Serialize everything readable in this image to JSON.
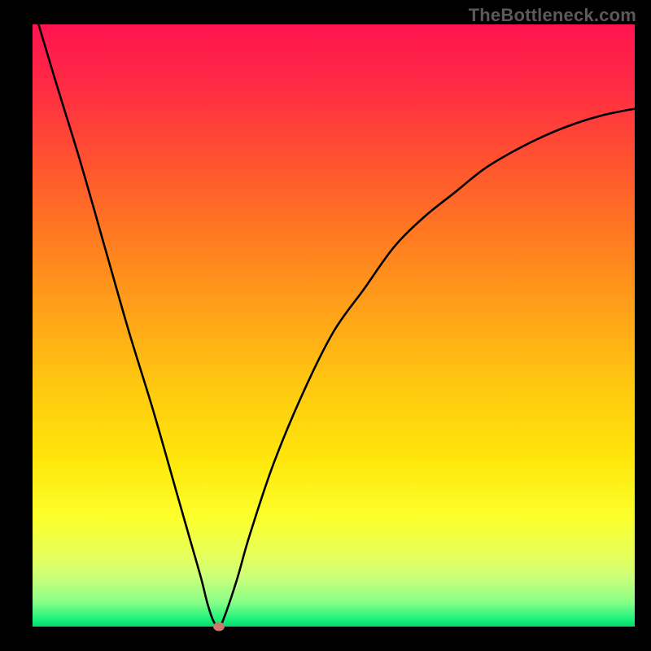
{
  "watermark": "TheBottleneck.com",
  "chart_data": {
    "type": "line",
    "title": "",
    "xlabel": "",
    "ylabel": "",
    "xlim": [
      0,
      100
    ],
    "ylim": [
      0,
      100
    ],
    "grid": false,
    "background_gradient": {
      "orientation": "vertical",
      "stops": [
        {
          "pos": 0.0,
          "color": "#ff1450"
        },
        {
          "pos": 0.1,
          "color": "#ff2a44"
        },
        {
          "pos": 0.22,
          "color": "#ff5030"
        },
        {
          "pos": 0.35,
          "color": "#ff7a21"
        },
        {
          "pos": 0.48,
          "color": "#ffa318"
        },
        {
          "pos": 0.6,
          "color": "#ffc810"
        },
        {
          "pos": 0.72,
          "color": "#ffe60a"
        },
        {
          "pos": 0.82,
          "color": "#fbff2c"
        },
        {
          "pos": 0.88,
          "color": "#e8ff5a"
        },
        {
          "pos": 0.92,
          "color": "#c8ff7a"
        },
        {
          "pos": 0.96,
          "color": "#88ff88"
        },
        {
          "pos": 0.99,
          "color": "#14f07a"
        },
        {
          "pos": 1.0,
          "color": "#08d868"
        }
      ]
    },
    "series": [
      {
        "name": "bottleneck-curve",
        "color": "#000000",
        "x": [
          1,
          4,
          8,
          12,
          16,
          20,
          24,
          26,
          28,
          29,
          30,
          31,
          32,
          34,
          36,
          40,
          45,
          50,
          55,
          60,
          65,
          70,
          75,
          80,
          85,
          90,
          95,
          100
        ],
        "y": [
          100,
          90,
          77,
          63,
          49,
          36,
          22,
          15,
          8,
          4,
          1,
          0,
          2,
          8,
          15,
          27,
          39,
          49,
          56,
          63,
          68,
          72,
          76,
          79,
          81.5,
          83.5,
          85,
          86
        ]
      }
    ],
    "valley_marker": {
      "x": 31,
      "y": 0,
      "color": "#cc7a70"
    }
  }
}
